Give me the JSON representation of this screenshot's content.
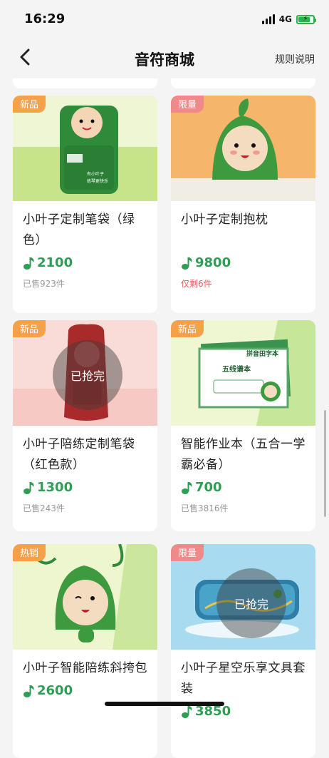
{
  "status_bar": {
    "time": "16:29",
    "network": "4G",
    "battery_icon": "battery-charging-icon"
  },
  "nav": {
    "title": "音符商城",
    "rules": "规则说明",
    "back_icon": "chevron-left-icon"
  },
  "colors": {
    "price_green": "#2f9e55",
    "tag_new": "#f5a14a",
    "tag_limited": "#f08a8a",
    "remaining_red": "#e45c5c"
  },
  "products": [
    {
      "tag": "新品",
      "tag_color": "orange",
      "name": "小叶子定制笔袋（绿色）",
      "price": "2100",
      "sales": "已售923件",
      "sold_out": false
    },
    {
      "tag": "限量",
      "tag_color": "pink",
      "name": "小叶子定制抱枕",
      "price": "9800",
      "sales": "仅剩6件",
      "sold_out": false
    },
    {
      "tag": "新品",
      "tag_color": "orange",
      "name": "小叶子陪练定制笔袋（红色款）",
      "price": "1300",
      "sales": "已售243件",
      "sold_out": true,
      "sold_out_label": "已抢完"
    },
    {
      "tag": "新品",
      "tag_color": "orange",
      "name": "智能作业本（五合一学霸必备）",
      "price": "700",
      "sales": "已售3816件",
      "sold_out": false
    },
    {
      "tag": "热销",
      "tag_color": "orange",
      "name": "小叶子智能陪练斜挎包",
      "price": "2600",
      "sales": "",
      "sold_out": false
    },
    {
      "tag": "限量",
      "tag_color": "pink",
      "name": "小叶子星空乐享文具套装",
      "price": "3850",
      "sales": "",
      "sold_out": true,
      "sold_out_label": "已抢完"
    }
  ],
  "product_images": {
    "p0": {
      "notebook_text_1": "有小叶子",
      "notebook_text_2": "练琴更快乐"
    },
    "p3": {
      "book_title_1": "五线谱本",
      "book_title_2": "拼音田字本"
    }
  }
}
